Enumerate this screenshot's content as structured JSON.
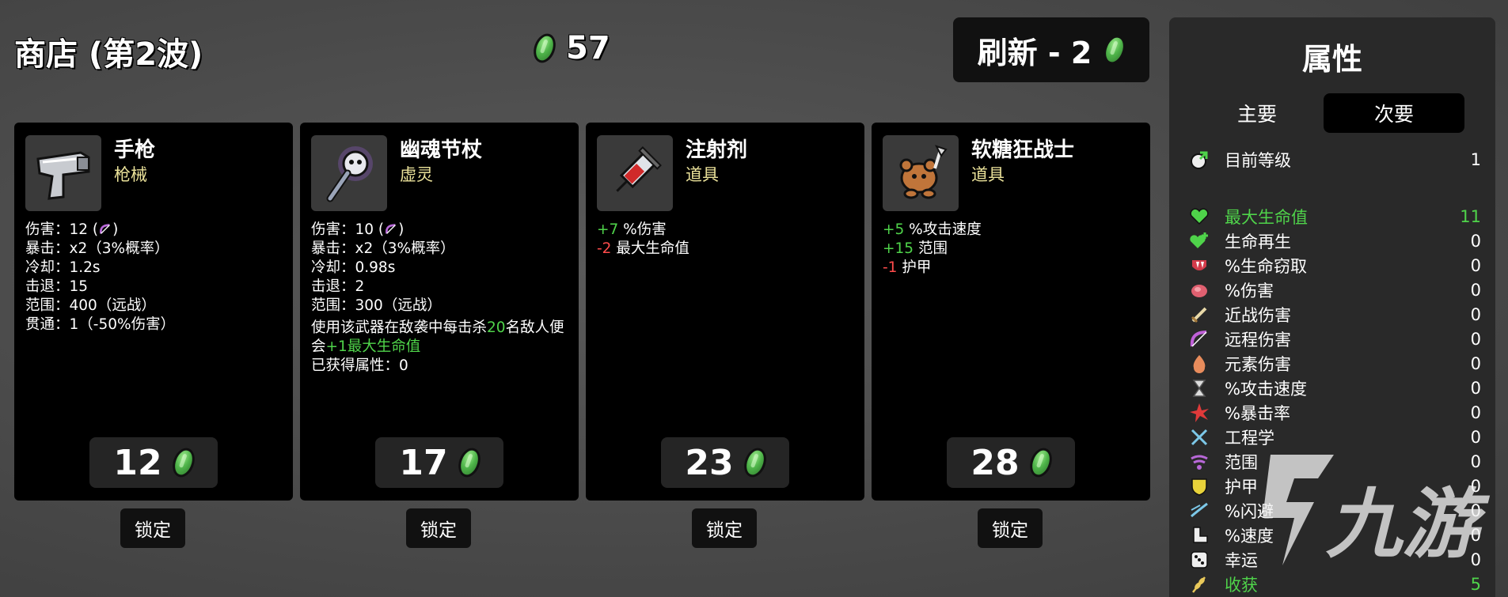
{
  "shop": {
    "title": "商店 (第2波)"
  },
  "gold": {
    "amount": "57",
    "icon": "material-icon"
  },
  "reroll": {
    "label": "刷新 - 2"
  },
  "items": [
    {
      "name": "手枪",
      "type": "枪械",
      "icon": "pistol-icon",
      "stats": [
        {
          "label": "伤害：",
          "value": "12 (",
          "tail": ")",
          "icon": "ranged-bow-icon"
        },
        {
          "label": "暴击：",
          "value": "x2（3%概率）"
        },
        {
          "label": "冷却：",
          "value": "1.2s"
        },
        {
          "label": "击退：",
          "value": "15"
        },
        {
          "label": "范围：",
          "value": "400（远战）"
        },
        {
          "label": "贯通：",
          "value": "1（-50%伤害）"
        }
      ],
      "price": "12",
      "lock_label": "锁定"
    },
    {
      "name": "幽魂节杖",
      "type": "虚灵",
      "icon": "ghost-scepter-icon",
      "stats": [
        {
          "label": "伤害：",
          "value": "10 (",
          "tail": ")",
          "icon": "ranged-bow-icon"
        },
        {
          "label": "暴击：",
          "value": "x2（3%概率）"
        },
        {
          "label": "冷却：",
          "value": "0.98s"
        },
        {
          "label": "击退：",
          "value": "2"
        },
        {
          "label": "范围：",
          "value": "300（远战）"
        }
      ],
      "effect": {
        "a": "使用该武器在敌袭中每击杀",
        "n": "20",
        "b": "名敌人便会",
        "bonus": "+1最大生命值"
      },
      "gained": "已获得属性：0",
      "price": "17",
      "lock_label": "锁定"
    },
    {
      "name": "注射剂",
      "type": "道具",
      "icon": "syringe-icon",
      "mods": [
        {
          "amount": "+7",
          "sign": "positive",
          "label": "%伤害"
        },
        {
          "amount": "-2",
          "sign": "negative",
          "label": "最大生命值"
        }
      ],
      "price": "23",
      "lock_label": "锁定"
    },
    {
      "name": "软糖狂战士",
      "type": "道具",
      "icon": "gummy-berserker-icon",
      "mods": [
        {
          "amount": "+5",
          "sign": "positive",
          "label": "%攻击速度"
        },
        {
          "amount": "+15",
          "sign": "positive",
          "label": "范围"
        },
        {
          "amount": "-1",
          "sign": "negative",
          "label": "护甲"
        }
      ],
      "price": "28",
      "lock_label": "锁定"
    }
  ],
  "stats_panel": {
    "title": "属性",
    "tabs": [
      "主要",
      "次要"
    ],
    "level": {
      "label": "目前等级",
      "value": "1",
      "icon": "level-up-icon"
    },
    "rows": [
      {
        "label": "最大生命值",
        "value": "11",
        "icon": "heart-icon",
        "highlight": true
      },
      {
        "label": "生命再生",
        "value": "0",
        "icon": "heart-plus-icon"
      },
      {
        "label": "%生命窃取",
        "value": "0",
        "icon": "fang-icon"
      },
      {
        "label": "%伤害",
        "value": "0",
        "icon": "muscle-icon"
      },
      {
        "label": "近战伤害",
        "value": "0",
        "icon": "sword-icon"
      },
      {
        "label": "远程伤害",
        "value": "0",
        "icon": "bow-icon"
      },
      {
        "label": "元素伤害",
        "value": "0",
        "icon": "flame-icon"
      },
      {
        "label": "%攻击速度",
        "value": "0",
        "icon": "hourglass-icon"
      },
      {
        "label": "%暴击率",
        "value": "0",
        "icon": "crit-burst-icon"
      },
      {
        "label": "工程学",
        "value": "0",
        "icon": "wrench-icon"
      },
      {
        "label": "范围",
        "value": "0",
        "icon": "range-waves-icon"
      },
      {
        "label": "护甲",
        "value": "0",
        "icon": "shield-icon"
      },
      {
        "label": "%闪避",
        "value": "0",
        "icon": "dodge-icon"
      },
      {
        "label": "%速度",
        "value": "0",
        "icon": "boot-icon"
      },
      {
        "label": "幸运",
        "value": "0",
        "icon": "dice-icon"
      },
      {
        "label": "收获",
        "value": "5",
        "icon": "wheat-icon",
        "highlight": true
      }
    ]
  },
  "watermark": {
    "text": "九游",
    "icon": "jiuyou-logo-icon"
  },
  "colors": {
    "positive": "#4fd34a",
    "negative": "#ff4c4c",
    "item_type": "#ebe29a",
    "card_bg": "#000000"
  }
}
